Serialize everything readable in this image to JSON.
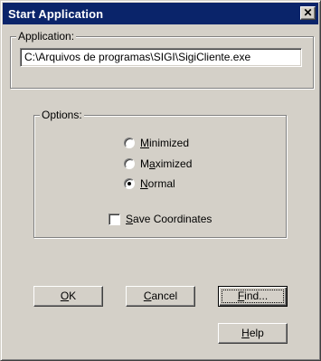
{
  "window": {
    "title": "Start Application",
    "close_glyph": "✕"
  },
  "application_group": {
    "label": "Application:",
    "path_value": "C:\\Arquivos de programas\\SIGI\\SigiCliente.exe"
  },
  "options_group": {
    "label": "Options:",
    "radios": [
      {
        "label": "Minimized",
        "mnemonic": "M",
        "rest": "inimized",
        "selected": false
      },
      {
        "label": "Maximized",
        "pre": "M",
        "mnemonic": "a",
        "rest": "ximized",
        "selected": false
      },
      {
        "label": "Normal",
        "mnemonic": "N",
        "rest": "ormal",
        "selected": true
      }
    ],
    "save_coordinates": {
      "label": "Save Coordinates",
      "mnemonic": "S",
      "rest": "ave Coordinates",
      "checked": false
    }
  },
  "buttons": {
    "ok": {
      "mnemonic": "O",
      "rest": "K"
    },
    "cancel": {
      "mnemonic": "C",
      "rest": "ancel"
    },
    "find": {
      "mnemonic": "F",
      "rest": "ind..."
    },
    "help": {
      "mnemonic": "H",
      "rest": "elp"
    }
  },
  "colors": {
    "titlebar": "#0a246a",
    "face": "#d4d0c8"
  }
}
